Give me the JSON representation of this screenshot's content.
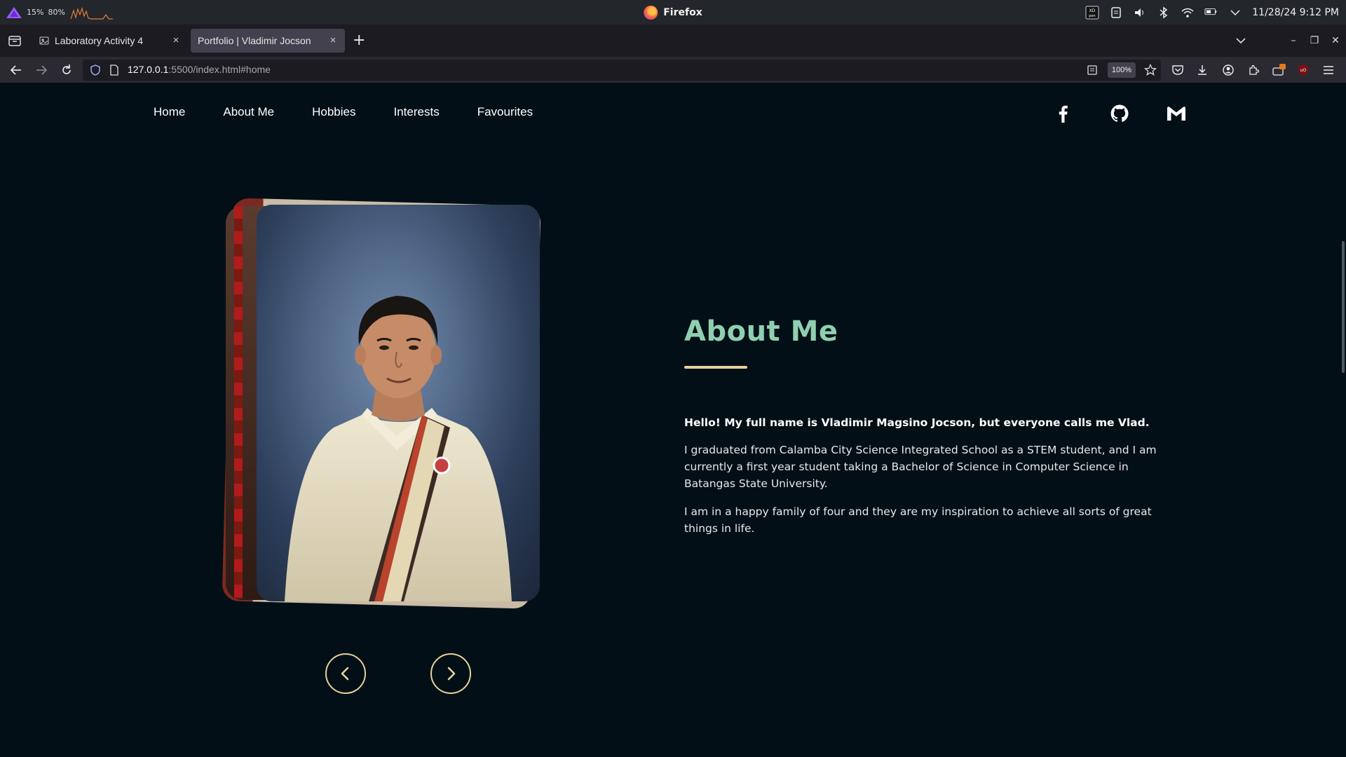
{
  "os": {
    "cpu": "15%",
    "mem": "80%",
    "app_title": "Firefox",
    "datetime": "11/28/24 9:12 PM",
    "battery": "41%"
  },
  "browser": {
    "tabs": [
      {
        "label": "Laboratory Activity 4",
        "active": false
      },
      {
        "label": "Portfolio | Vladimir Jocson",
        "active": true
      }
    ],
    "url_host": "127.0.0.1",
    "url_rest": ":5500/index.html#home",
    "zoom": "100%"
  },
  "site": {
    "nav": [
      "Home",
      "About Me",
      "Hobbies",
      "Interests",
      "Favourites"
    ],
    "socials": [
      "facebook-icon",
      "github-icon",
      "gmail-icon"
    ],
    "accent_title": "#8fcfb0",
    "accent_gold": "#e6d29b",
    "bg": "#020f17"
  },
  "about": {
    "title": "About Me",
    "lead": "Hello! My full name is Vladimir Magsino Jocson, but everyone calls me Vlad.",
    "p1": "I graduated from Calamba City Science Integrated School as a STEM student, and I am currently a first year student taking a Bachelor of Science in Computer Science in Batangas State University.",
    "p2": "I am in a happy family of four and they are my inspiration to achieve all sorts of great things in life."
  }
}
